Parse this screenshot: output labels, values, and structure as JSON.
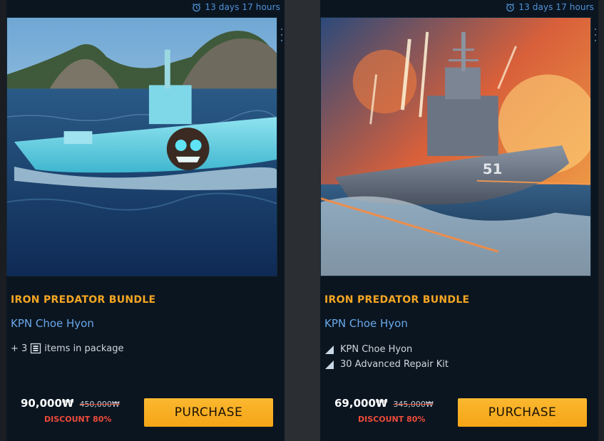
{
  "cards": [
    {
      "timer": "13 days 17 hours",
      "bundle_title": "IRON PREDATOR BUNDLE",
      "ship_name": "KPN Choe Hyon",
      "contents_prefix": "+ 3",
      "contents_suffix": "items in package",
      "price_now": "90,000₩",
      "price_old": "450,000₩",
      "discount": "DISCOUNT 80%",
      "purchase_label": "PURCHASE"
    },
    {
      "timer": "13 days 17 hours",
      "bundle_title": "IRON PREDATOR BUNDLE",
      "ship_name": "KPN Choe Hyon",
      "items": [
        "KPN Choe Hyon",
        "30 Advanced Repair Kit"
      ],
      "price_now": "69,000₩",
      "price_old": "345,000₩",
      "discount": "DISCOUNT 80%",
      "purchase_label": "PURCHASE"
    }
  ],
  "colors": {
    "accent_orange": "#f5a623",
    "ship_name_blue": "#6aa8e8",
    "timer_blue": "#4f93d8",
    "discount_red": "#ef4b3a",
    "card_bg": "#0a1520"
  },
  "icons": {
    "timer": "alarm-clock-icon",
    "package": "package-icon",
    "item": "triangle-bullet-icon",
    "menu": "kebab-menu-icon"
  }
}
